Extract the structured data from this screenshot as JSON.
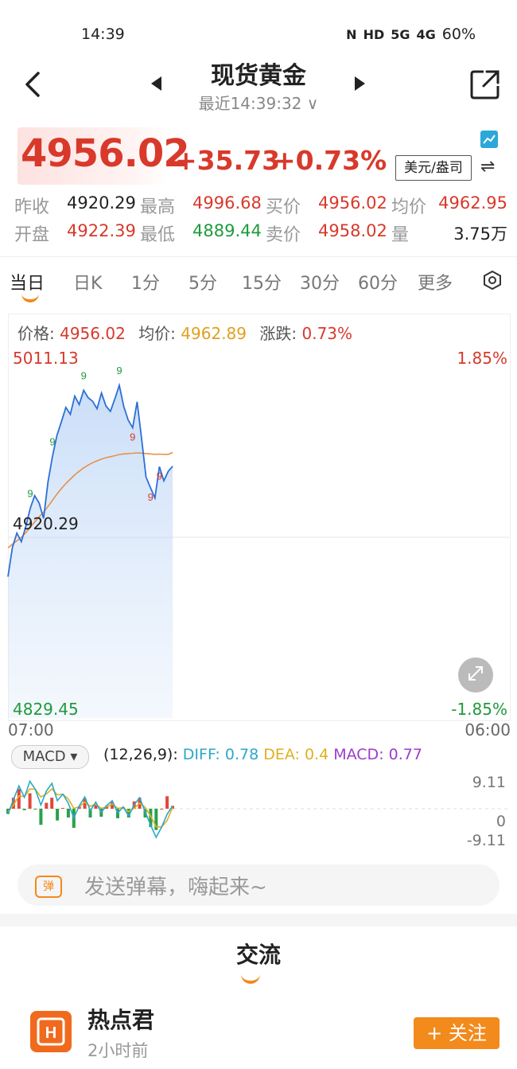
{
  "status_bar": {
    "time": "14:39",
    "nfc": "N",
    "hd": "HD",
    "net1": "5G",
    "net2": "4G",
    "battery": "60%"
  },
  "header": {
    "title": "现货黄金",
    "subtitle": "最近14:39:32 ∨"
  },
  "quote": {
    "price": "4956.02",
    "change": "+35.73",
    "change_pct": "+0.73%",
    "unit": "美元/盎司",
    "swap_symbol": "⇌"
  },
  "stats": [
    [
      {
        "label": "昨收",
        "value": "4920.29",
        "color": "dark"
      },
      {
        "label": "最高",
        "value": "4996.68",
        "color": "red"
      },
      {
        "label": "买价",
        "value": "4956.02",
        "color": "red"
      },
      {
        "label": "均价",
        "value": "4962.95",
        "color": "red"
      }
    ],
    [
      {
        "label": "开盘",
        "value": "4922.39",
        "color": "red"
      },
      {
        "label": "最低",
        "value": "4889.44",
        "color": "green"
      },
      {
        "label": "卖价",
        "value": "4958.02",
        "color": "red"
      },
      {
        "label": "量",
        "value": "3.75万",
        "color": "dark"
      }
    ]
  ],
  "tabs": [
    "当日",
    "日K",
    "1分",
    "5分",
    "15分",
    "30分",
    "60分",
    "更多"
  ],
  "active_tab": "当日",
  "chart_info": {
    "price_label": "价格:",
    "price_value": "4956.02",
    "avg_label": "均价:",
    "avg_value": "4962.89",
    "chg_label": "涨跌:",
    "chg_value": "0.73%"
  },
  "chart_axes": {
    "y_top": "5011.13",
    "y_mid": "4920.29",
    "y_bottom": "4829.45",
    "pct_top": "1.85%",
    "pct_bottom": "-1.85%",
    "x_start": "07:00",
    "x_end": "06:00"
  },
  "macd": {
    "button_label": "MACD ▾",
    "params": "(12,26,9):",
    "diff_label": "DIFF: 0.78",
    "dea_label": "DEA: 0.4",
    "macd_label": "MACD: 0.77",
    "y_top": "9.11",
    "y_mid": "0",
    "y_bottom": "-9.11"
  },
  "danmaku": {
    "icon_text": "弹",
    "placeholder": "发送弹幕，嗨起来~"
  },
  "community": {
    "section_title": "交流",
    "user_name": "热点君",
    "post_time": "2小时前",
    "follow_label": "+ 关注",
    "avatar_letter": "H"
  },
  "colors": {
    "up": "#d8392b",
    "down": "#1f9a3c",
    "accent": "#f28a1c",
    "price_line": "#2d6fd6",
    "avg_line": "#e8914a",
    "diff_line": "#2ba8c8",
    "dea_line": "#e0b020",
    "macd_text": "#9b3fc8"
  },
  "chart_data": {
    "type": "line",
    "title": "",
    "x_range": [
      "07:00",
      "06:00"
    ],
    "ylim": [
      4829.45,
      5011.13
    ],
    "baseline": 4920.29,
    "series": [
      {
        "values": [
          4900.5,
          4915.2,
          4922.4,
          4918.1,
          4925.6,
          4934.8,
          4941.2,
          4937.5,
          4929.8,
          4948.3,
          4961.0,
          4971.5,
          4978.4,
          4985.6,
          4982.1,
          4991.3,
          4987.0,
          4994.2,
          4990.5,
          4988.7,
          4984.9,
          4992.8,
          4986.3,
          4983.6,
          4989.9,
          4996.7,
          4986.0,
          4979.2,
          4975.4,
          4988.4,
          4970.0,
          4950.6,
          4945.2,
          4940.1,
          4955.8,
          4948.7,
          4953.5,
          4956.02
        ]
      },
      {
        "values": [
          4915.0,
          4916.8,
          4918.5,
          4920.3,
          4922.6,
          4925.3,
          4928.0,
          4930.6,
          4932.9,
          4935.8,
          4938.9,
          4942.0,
          4944.8,
          4947.3,
          4949.5,
          4951.7,
          4953.5,
          4955.2,
          4956.6,
          4957.8,
          4958.7,
          4959.6,
          4960.3,
          4960.8,
          4961.3,
          4961.9,
          4962.2,
          4962.4,
          4962.5,
          4962.7,
          4962.6,
          4962.4,
          4962.2,
          4962.0,
          4962.1,
          4962.0,
          4962.0,
          4962.89
        ]
      }
    ]
  },
  "macd_data": {
    "ylim": [
      -9.11,
      9.11
    ],
    "diff": [
      -1.5,
      2.5,
      6.2,
      3.1,
      7.5,
      5.2,
      1.0,
      4.8,
      6.9,
      2.2,
      4.0,
      1.5,
      -2.5,
      0.8,
      3.2,
      -0.5,
      1.8,
      -1.0,
      0.9,
      2.2,
      -1.2,
      0.5,
      -2.0,
      1.1,
      3.0,
      -0.8,
      -4.5,
      -7.8,
      -5.0,
      -1.5,
      0.78
    ],
    "dea": [
      -0.8,
      1.0,
      3.5,
      3.3,
      5.4,
      5.3,
      3.2,
      4.0,
      5.4,
      3.8,
      3.9,
      2.7,
      0.1,
      0.5,
      1.8,
      0.7,
      1.2,
      0.1,
      0.5,
      1.3,
      0.1,
      0.3,
      -0.8,
      0.1,
      1.5,
      0.4,
      -2.0,
      -4.9,
      -5.0,
      -3.2,
      0.4
    ],
    "hist": [
      -1.4,
      3.0,
      5.4,
      -0.4,
      4.2,
      -0.2,
      -4.4,
      1.6,
      3.0,
      -3.2,
      0.2,
      -2.4,
      -5.2,
      0.6,
      2.8,
      -2.4,
      1.2,
      -2.2,
      0.8,
      1.8,
      -2.6,
      0.4,
      -2.4,
      2.0,
      3.0,
      -2.4,
      -5.0,
      -5.8,
      0.0,
      3.4,
      0.77
    ]
  }
}
